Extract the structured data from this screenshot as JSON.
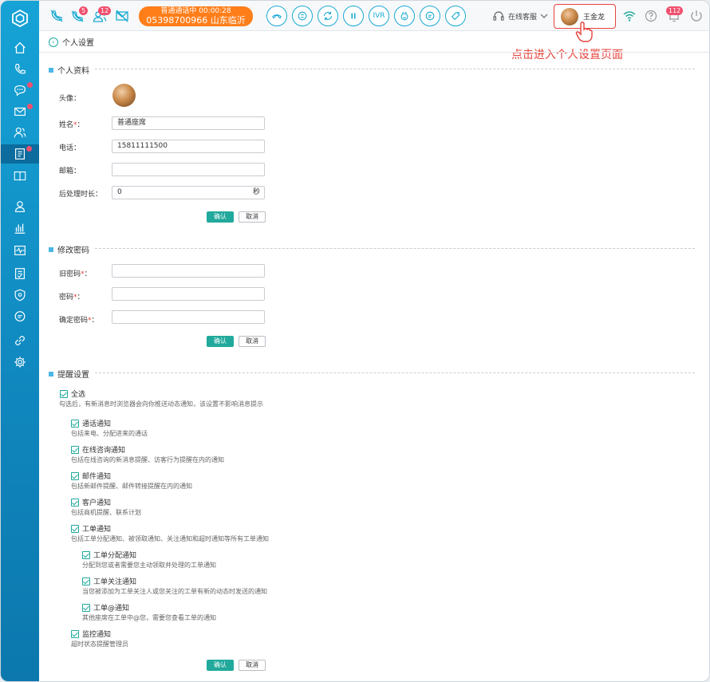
{
  "topbar": {
    "badge_missed": "5",
    "badge_agents": "12",
    "call_status": "普通通话中  00:00:28",
    "call_number": "05398700966 山东临沂",
    "ivr_label": "IVR",
    "service_label": "在线客服",
    "user_name": "王金龙",
    "badge_notify": "112"
  },
  "annotation": "点击进入个人设置页面",
  "page": {
    "title": "个人设置"
  },
  "profile": {
    "section_title": "个人资料",
    "avatar_label": "头像：",
    "name_label": "姓名",
    "name_value": "普通座席",
    "phone_label": "电话：",
    "phone_value": "15811111500",
    "email_label": "邮箱：",
    "email_value": "",
    "post_label": "后处理时长：",
    "post_value": "0",
    "post_unit": "秒",
    "req_mark": "*",
    "colon": "：",
    "confirm": "确认",
    "cancel": "取消"
  },
  "password": {
    "section_title": "修改密码",
    "old_label": "旧密码",
    "new_label": "密码",
    "confirm_label": "确定密码",
    "confirm": "确认",
    "cancel": "取消"
  },
  "reminders": {
    "section_title": "提醒设置",
    "select_all": "全选",
    "select_all_desc": "勾选后，有新消息时浏览器会向你推送动态通知，该设置不影响消息提示",
    "items": [
      {
        "label": "通话通知",
        "desc": "包括来电、分配进来的通话"
      },
      {
        "label": "在线咨询通知",
        "desc": "包括在线咨询的新消息提醒、访客行为提醒在内的通知"
      },
      {
        "label": "邮件通知",
        "desc": "包括新邮件提醒、邮件转接提醒在内的通知"
      },
      {
        "label": "客户通知",
        "desc": "包括商机提醒、联系计划"
      },
      {
        "label": "工单通知",
        "desc": "包括工单分配通知、被领取通知、关注通知和超时通知等所有工单通知"
      },
      {
        "label": "工单分配通知",
        "desc": "分配到您或者需要您主动领取并处理的工单通知"
      },
      {
        "label": "工单关注通知",
        "desc": "当您被添加为工单关注人或您关注的工单有新的动态时发送的通知"
      },
      {
        "label": "工单@通知",
        "desc": "其他座席在工单中@您，需要您查看工单的通知"
      },
      {
        "label": "监控通知",
        "desc": "超时状态提醒管理员"
      }
    ],
    "confirm": "确认",
    "cancel": "取消"
  },
  "colors": {
    "accent": "#21a99c",
    "sidebar": "#1296c9",
    "callbox": "#ff7e1a",
    "highlight": "#e8423b"
  }
}
